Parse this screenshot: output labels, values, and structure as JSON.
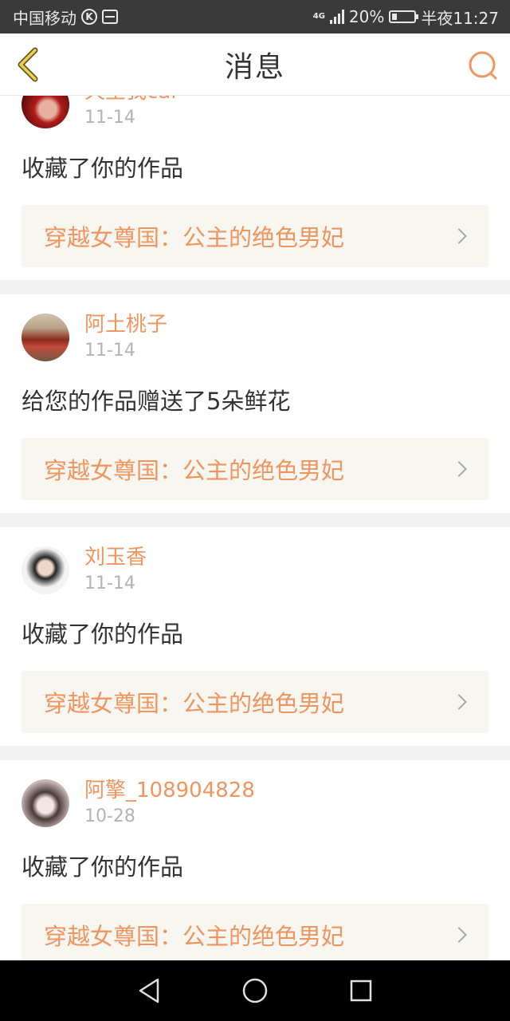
{
  "status_bar": {
    "carrier": "中国移动",
    "k_badge": "K",
    "network": "4G",
    "battery": "20%",
    "time": "半夜11:27"
  },
  "header": {
    "title": "消息",
    "back_icon": "chevron-left-icon",
    "search_icon": "search-icon"
  },
  "accent_color": "#f0955e",
  "messages": [
    {
      "user": "天生我cai",
      "date": "11-14",
      "action": "收藏了你的作品",
      "work": "穿越女尊国：公主的绝色男妃"
    },
    {
      "user": "阿土桃子",
      "date": "11-14",
      "action": "给您的作品赠送了5朵鲜花",
      "work": "穿越女尊国：公主的绝色男妃"
    },
    {
      "user": "刘玉香",
      "date": "11-14",
      "action": "收藏了你的作品",
      "work": "穿越女尊国：公主的绝色男妃"
    },
    {
      "user": "阿擎_108904828",
      "date": "10-28",
      "action": "收藏了你的作品",
      "work": "穿越女尊国：公主的绝色男妃"
    }
  ],
  "nav_bar": {
    "back": "triangle-back-icon",
    "home": "circle-home-icon",
    "recents": "square-recents-icon"
  }
}
